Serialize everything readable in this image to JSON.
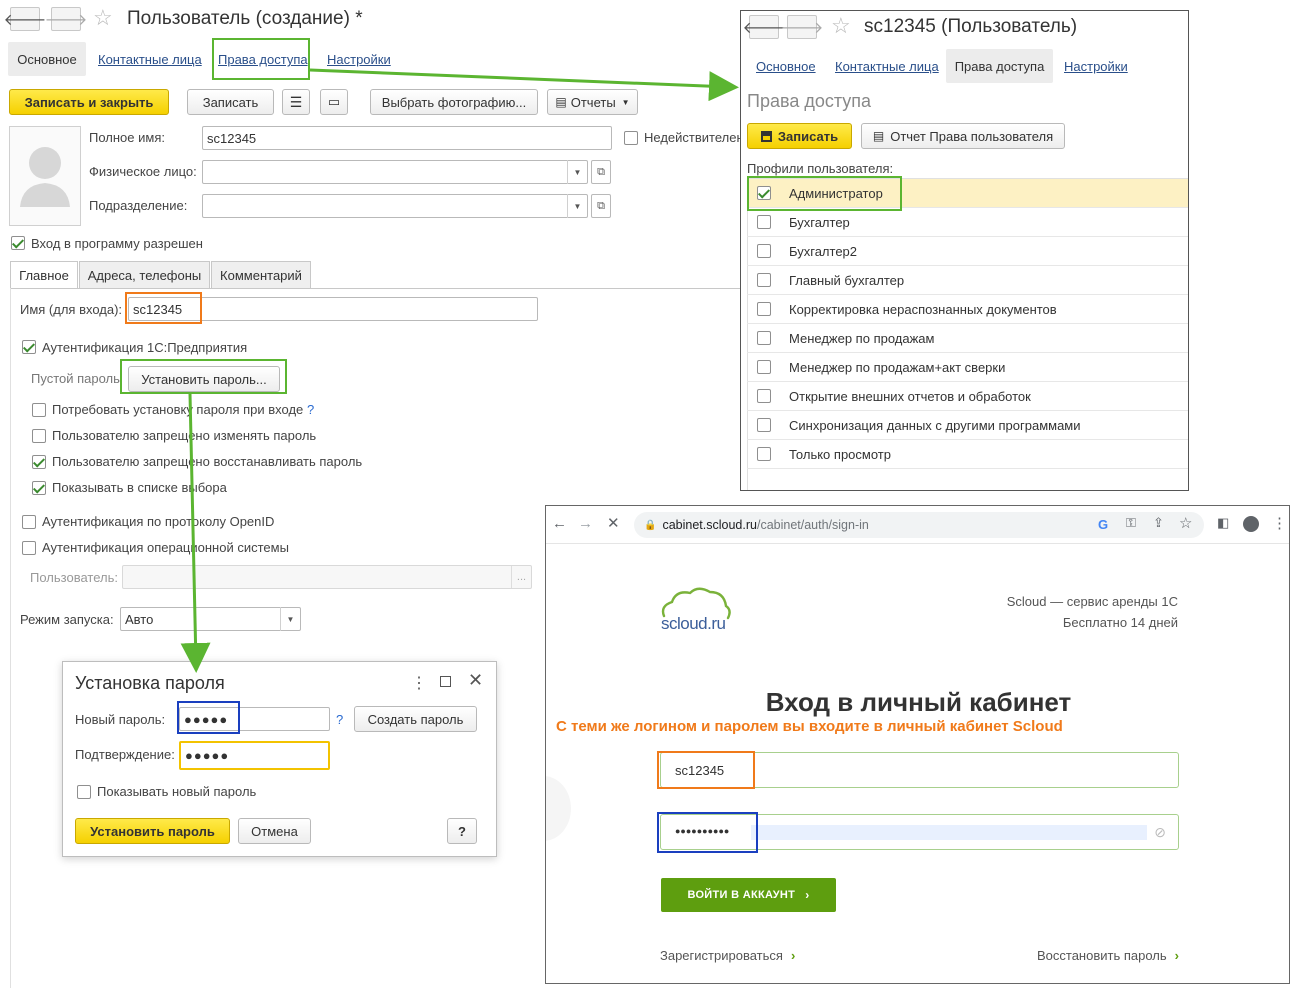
{
  "main": {
    "title": "Пользователь (создание) *",
    "tabs_top": [
      "Основное",
      "Контактные лица",
      "Права доступа",
      "Настройки"
    ],
    "toolbar": {
      "save_close": "Записать и закрыть",
      "save": "Записать",
      "choose_photo": "Выбрать фотографию...",
      "reports": "Отчеты"
    },
    "fields": {
      "full_name_label": "Полное имя:",
      "full_name_value": "sc12345",
      "person_label": "Физическое лицо:",
      "department_label": "Подразделение:",
      "invalid_label": "Недействителен"
    },
    "login_allowed": "Вход в программу разрешен",
    "tabs_inner": [
      "Главное",
      "Адреса, телефоны",
      "Комментарий"
    ],
    "login_label": "Имя (для входа):",
    "login_value": "sc12345",
    "auth_1c": "Аутентификация 1С:Предприятия",
    "empty_password": "Пустой пароль",
    "set_password_btn": "Установить пароль...",
    "options": [
      {
        "text": "Потребовать установку пароля при входе",
        "checked": false,
        "help": "?"
      },
      {
        "text": "Пользователю запрещено изменять пароль",
        "checked": false
      },
      {
        "text": "Пользователю запрещено восстанавливать пароль",
        "checked": true
      },
      {
        "text": "Показывать в списке выбора",
        "checked": true
      }
    ],
    "auth_openid": "Аутентификация по протоколу OpenID",
    "auth_os": "Аутентификация операционной системы",
    "os_user_label": "Пользователь:",
    "os_user_btn": "...",
    "launch_mode_label": "Режим запуска:",
    "launch_mode_value": "Авто"
  },
  "rights_window": {
    "title": "sc12345 (Пользователь)",
    "tabs": [
      "Основное",
      "Контактные лица",
      "Права доступа",
      "Настройки"
    ],
    "section_title": "Права доступа",
    "save": "Записать",
    "report": "Отчет Права пользователя",
    "profiles_label": "Профили пользователя:",
    "profiles": [
      {
        "name": "Администратор",
        "checked": true
      },
      {
        "name": "Бухгалтер",
        "checked": false
      },
      {
        "name": "Бухгалтер2",
        "checked": false
      },
      {
        "name": "Главный бухгалтер",
        "checked": false
      },
      {
        "name": "Корректировка нераспознанных документов",
        "checked": false
      },
      {
        "name": "Менеджер по продажам",
        "checked": false
      },
      {
        "name": "Менеджер по продажам+акт сверки",
        "checked": false
      },
      {
        "name": "Открытие внешних отчетов и обработок",
        "checked": false
      },
      {
        "name": "Синхронизация данных с другими программами",
        "checked": false
      },
      {
        "name": "Только просмотр",
        "checked": false
      }
    ]
  },
  "password_dialog": {
    "title": "Установка пароля",
    "new_password_label": "Новый пароль:",
    "new_password_value": "●●●●●",
    "help": "?",
    "generate": "Создать пароль",
    "confirm_label": "Подтверждение:",
    "confirm_value": "●●●●●",
    "show_password": "Показывать новый пароль",
    "set_btn": "Установить пароль",
    "cancel_btn": "Отмена",
    "help_btn": "?"
  },
  "browser": {
    "url_host": "cabinet.scloud.ru",
    "url_path": "/cabinet/auth/sign-in",
    "logo_text": "scloud.ru",
    "tagline1": "Scloud — сервис аренды 1С",
    "tagline2": "Бесплатно 14 дней",
    "heading": "Вход в личный кабинет",
    "note": "С теми же логином и паролем вы входите в личный кабинет Scloud",
    "login_value": "sc12345",
    "password_value": "●●●●●●●●●●",
    "login_btn": "ВОЙТИ В АККАУНТ",
    "register": "Зарегистрироваться",
    "restore": "Восстановить пароль"
  },
  "colors": {
    "highlight_green": "#5bb531",
    "highlight_orange": "#f07a1a",
    "highlight_blue": "#1a3fbf",
    "highlight_yellow": "#f3c300",
    "scloud_green": "#5e9e0f",
    "note_orange": "#f07a1a"
  }
}
